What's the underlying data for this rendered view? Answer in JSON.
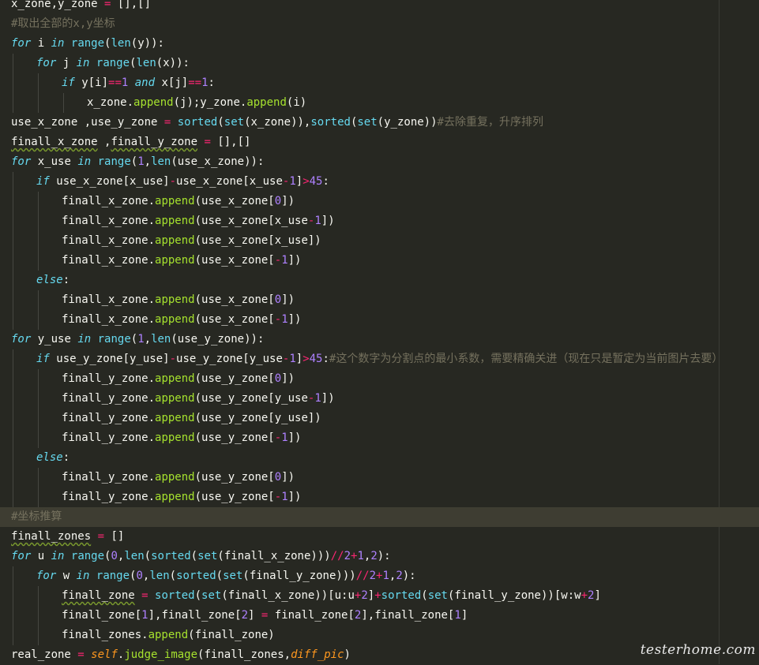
{
  "editor": {
    "colors": {
      "background": "#272822",
      "highlight": "#3e3d32",
      "text": "#f8f8f2",
      "keyword": "#66d9ef",
      "operator": "#f92672",
      "function": "#a6e22e",
      "number": "#ae81ff",
      "comment": "#75715e",
      "self": "#fd971f"
    },
    "lines": [
      {
        "indent": 0,
        "tokens": [
          [
            "x_zone,y_zone ",
            "t-default"
          ],
          [
            "=",
            "t-op"
          ],
          [
            " [],[]",
            "t-punc"
          ]
        ]
      },
      {
        "indent": 0,
        "tokens": [
          [
            "#取出全部的x,y坐标",
            "t-cm"
          ]
        ]
      },
      {
        "indent": 0,
        "tokens": [
          [
            "for",
            "t-kw"
          ],
          [
            " i ",
            "t-default"
          ],
          [
            "in",
            "t-kw"
          ],
          [
            " ",
            "t-default"
          ],
          [
            "range",
            "t-bi"
          ],
          [
            "(",
            "t-punc"
          ],
          [
            "len",
            "t-bi"
          ],
          [
            "(y)):",
            "t-punc"
          ]
        ]
      },
      {
        "indent": 1,
        "tokens": [
          [
            "for",
            "t-kw"
          ],
          [
            " j ",
            "t-default"
          ],
          [
            "in",
            "t-kw"
          ],
          [
            " ",
            "t-default"
          ],
          [
            "range",
            "t-bi"
          ],
          [
            "(",
            "t-punc"
          ],
          [
            "len",
            "t-bi"
          ],
          [
            "(x)):",
            "t-punc"
          ]
        ]
      },
      {
        "indent": 2,
        "tokens": [
          [
            "if",
            "t-kw"
          ],
          [
            " y[i]",
            "t-default"
          ],
          [
            "==",
            "t-op"
          ],
          [
            "1",
            "t-num"
          ],
          [
            " ",
            "t-default"
          ],
          [
            "and",
            "t-kw"
          ],
          [
            " x[j]",
            "t-default"
          ],
          [
            "==",
            "t-op"
          ],
          [
            "1",
            "t-num"
          ],
          [
            ":",
            "t-punc"
          ]
        ]
      },
      {
        "indent": 3,
        "tokens": [
          [
            "x_zone.",
            "t-default"
          ],
          [
            "append",
            "t-fn"
          ],
          [
            "(j);y_zone.",
            "t-default"
          ],
          [
            "append",
            "t-fn"
          ],
          [
            "(i)",
            "t-default"
          ]
        ]
      },
      {
        "indent": 0,
        "tokens": [
          [
            "use_x_zone ,use_y_zone ",
            "t-default"
          ],
          [
            "=",
            "t-op"
          ],
          [
            " ",
            "t-default"
          ],
          [
            "sorted",
            "t-bi"
          ],
          [
            "(",
            "t-punc"
          ],
          [
            "set",
            "t-bi"
          ],
          [
            "(x_zone)),",
            "t-default"
          ],
          [
            "sorted",
            "t-bi"
          ],
          [
            "(",
            "t-punc"
          ],
          [
            "set",
            "t-bi"
          ],
          [
            "(y_zone))",
            "t-default"
          ],
          [
            "#去除重复，升序排列",
            "t-cm"
          ]
        ]
      },
      {
        "indent": 0,
        "tokens": [
          [
            "finall_x_zone",
            "t-default u-wavy"
          ],
          [
            " ,",
            "t-default"
          ],
          [
            "finall_y_zone",
            "t-default u-wavy"
          ],
          [
            " ",
            "t-default"
          ],
          [
            "=",
            "t-op"
          ],
          [
            " [],[]",
            "t-punc"
          ]
        ]
      },
      {
        "indent": 0,
        "tokens": [
          [
            "for",
            "t-kw"
          ],
          [
            " x_use ",
            "t-default"
          ],
          [
            "in",
            "t-kw"
          ],
          [
            " ",
            "t-default"
          ],
          [
            "range",
            "t-bi"
          ],
          [
            "(",
            "t-punc"
          ],
          [
            "1",
            "t-num"
          ],
          [
            ",",
            "t-punc"
          ],
          [
            "len",
            "t-bi"
          ],
          [
            "(use_x_zone)):",
            "t-default"
          ]
        ]
      },
      {
        "indent": 1,
        "tokens": [
          [
            "if",
            "t-kw"
          ],
          [
            " use_x_zone[x_use]",
            "t-default"
          ],
          [
            "-",
            "t-op"
          ],
          [
            "use_x_zone[x_use",
            "t-default"
          ],
          [
            "-",
            "t-op"
          ],
          [
            "1",
            "t-num"
          ],
          [
            "]",
            "t-default"
          ],
          [
            ">",
            "t-op"
          ],
          [
            "45",
            "t-num"
          ],
          [
            ":",
            "t-punc"
          ]
        ]
      },
      {
        "indent": 2,
        "tokens": [
          [
            "finall_x_zone.",
            "t-default"
          ],
          [
            "append",
            "t-fn"
          ],
          [
            "(use_x_zone[",
            "t-default"
          ],
          [
            "0",
            "t-num"
          ],
          [
            "])",
            "t-default"
          ]
        ]
      },
      {
        "indent": 2,
        "tokens": [
          [
            "finall_x_zone.",
            "t-default"
          ],
          [
            "append",
            "t-fn"
          ],
          [
            "(use_x_zone[x_use",
            "t-default"
          ],
          [
            "-",
            "t-op"
          ],
          [
            "1",
            "t-num"
          ],
          [
            "])",
            "t-default"
          ]
        ]
      },
      {
        "indent": 2,
        "tokens": [
          [
            "finall_x_zone.",
            "t-default"
          ],
          [
            "append",
            "t-fn"
          ],
          [
            "(use_x_zone[x_use])",
            "t-default"
          ]
        ]
      },
      {
        "indent": 2,
        "tokens": [
          [
            "finall_x_zone.",
            "t-default"
          ],
          [
            "append",
            "t-fn"
          ],
          [
            "(use_x_zone[",
            "t-default"
          ],
          [
            "-",
            "t-op"
          ],
          [
            "1",
            "t-num"
          ],
          [
            "])",
            "t-default"
          ]
        ]
      },
      {
        "indent": 1,
        "tokens": [
          [
            "else",
            "t-kw"
          ],
          [
            ":",
            "t-punc"
          ]
        ]
      },
      {
        "indent": 2,
        "tokens": [
          [
            "finall_x_zone.",
            "t-default"
          ],
          [
            "append",
            "t-fn"
          ],
          [
            "(use_x_zone[",
            "t-default"
          ],
          [
            "0",
            "t-num"
          ],
          [
            "])",
            "t-default"
          ]
        ]
      },
      {
        "indent": 2,
        "tokens": [
          [
            "finall_x_zone.",
            "t-default"
          ],
          [
            "append",
            "t-fn"
          ],
          [
            "(use_x_zone[",
            "t-default"
          ],
          [
            "-",
            "t-op"
          ],
          [
            "1",
            "t-num"
          ],
          [
            "])",
            "t-default"
          ]
        ]
      },
      {
        "indent": 0,
        "tokens": [
          [
            "for",
            "t-kw"
          ],
          [
            " y_use ",
            "t-default"
          ],
          [
            "in",
            "t-kw"
          ],
          [
            " ",
            "t-default"
          ],
          [
            "range",
            "t-bi"
          ],
          [
            "(",
            "t-punc"
          ],
          [
            "1",
            "t-num"
          ],
          [
            ",",
            "t-punc"
          ],
          [
            "len",
            "t-bi"
          ],
          [
            "(use_y_zone)):",
            "t-default"
          ]
        ]
      },
      {
        "indent": 1,
        "tokens": [
          [
            "if",
            "t-kw"
          ],
          [
            " use_y_zone[y_use]",
            "t-default"
          ],
          [
            "-",
            "t-op"
          ],
          [
            "use_y_zone[y_use",
            "t-default"
          ],
          [
            "-",
            "t-op"
          ],
          [
            "1",
            "t-num"
          ],
          [
            "]",
            "t-default"
          ],
          [
            ">",
            "t-op"
          ],
          [
            "45",
            "t-num"
          ],
          [
            ":",
            "t-punc"
          ],
          [
            "#这个数字为分割点的最小系数，需要精确关进（现在只是暂定为当前图片去要）",
            "t-cm"
          ]
        ]
      },
      {
        "indent": 2,
        "tokens": [
          [
            "finall_y_zone.",
            "t-default"
          ],
          [
            "append",
            "t-fn"
          ],
          [
            "(use_y_zone[",
            "t-default"
          ],
          [
            "0",
            "t-num"
          ],
          [
            "])",
            "t-default"
          ]
        ]
      },
      {
        "indent": 2,
        "tokens": [
          [
            "finall_y_zone.",
            "t-default"
          ],
          [
            "append",
            "t-fn"
          ],
          [
            "(use_y_zone[y_use",
            "t-default"
          ],
          [
            "-",
            "t-op"
          ],
          [
            "1",
            "t-num"
          ],
          [
            "])",
            "t-default"
          ]
        ]
      },
      {
        "indent": 2,
        "tokens": [
          [
            "finall_y_zone.",
            "t-default"
          ],
          [
            "append",
            "t-fn"
          ],
          [
            "(use_y_zone[y_use])",
            "t-default"
          ]
        ]
      },
      {
        "indent": 2,
        "tokens": [
          [
            "finall_y_zone.",
            "t-default"
          ],
          [
            "append",
            "t-fn"
          ],
          [
            "(use_y_zone[",
            "t-default"
          ],
          [
            "-",
            "t-op"
          ],
          [
            "1",
            "t-num"
          ],
          [
            "])",
            "t-default"
          ]
        ]
      },
      {
        "indent": 1,
        "tokens": [
          [
            "else",
            "t-kw"
          ],
          [
            ":",
            "t-punc"
          ]
        ]
      },
      {
        "indent": 2,
        "tokens": [
          [
            "finall_y_zone.",
            "t-default"
          ],
          [
            "append",
            "t-fn"
          ],
          [
            "(use_y_zone[",
            "t-default"
          ],
          [
            "0",
            "t-num"
          ],
          [
            "])",
            "t-default"
          ]
        ]
      },
      {
        "indent": 2,
        "tokens": [
          [
            "finall_y_zone.",
            "t-default"
          ],
          [
            "append",
            "t-fn"
          ],
          [
            "(use_y_zone[",
            "t-default"
          ],
          [
            "-",
            "t-op"
          ],
          [
            "1",
            "t-num"
          ],
          [
            "])",
            "t-default"
          ]
        ]
      },
      {
        "indent": 0,
        "highlight": true,
        "tokens": [
          [
            "#坐标推算",
            "t-cm"
          ]
        ]
      },
      {
        "indent": 0,
        "tokens": [
          [
            "finall_zones",
            "t-default u-wavy"
          ],
          [
            " ",
            "t-default"
          ],
          [
            "=",
            "t-op"
          ],
          [
            " []",
            "t-punc"
          ]
        ]
      },
      {
        "indent": 0,
        "tokens": [
          [
            "for",
            "t-kw"
          ],
          [
            " u ",
            "t-default"
          ],
          [
            "in",
            "t-kw"
          ],
          [
            " ",
            "t-default"
          ],
          [
            "range",
            "t-bi"
          ],
          [
            "(",
            "t-punc"
          ],
          [
            "0",
            "t-num"
          ],
          [
            ",",
            "t-punc"
          ],
          [
            "len",
            "t-bi"
          ],
          [
            "(",
            "t-punc"
          ],
          [
            "sorted",
            "t-bi"
          ],
          [
            "(",
            "t-punc"
          ],
          [
            "set",
            "t-bi"
          ],
          [
            "(finall_x_zone)))",
            "t-default"
          ],
          [
            "//",
            "t-op"
          ],
          [
            "2",
            "t-num"
          ],
          [
            "+",
            "t-op"
          ],
          [
            "1",
            "t-num"
          ],
          [
            ",",
            "t-punc"
          ],
          [
            "2",
            "t-num"
          ],
          [
            "):",
            "t-punc"
          ]
        ]
      },
      {
        "indent": 1,
        "tokens": [
          [
            "for",
            "t-kw"
          ],
          [
            " w ",
            "t-default"
          ],
          [
            "in",
            "t-kw"
          ],
          [
            " ",
            "t-default"
          ],
          [
            "range",
            "t-bi"
          ],
          [
            "(",
            "t-punc"
          ],
          [
            "0",
            "t-num"
          ],
          [
            ",",
            "t-punc"
          ],
          [
            "len",
            "t-bi"
          ],
          [
            "(",
            "t-punc"
          ],
          [
            "sorted",
            "t-bi"
          ],
          [
            "(",
            "t-punc"
          ],
          [
            "set",
            "t-bi"
          ],
          [
            "(finall_y_zone)))",
            "t-default"
          ],
          [
            "//",
            "t-op"
          ],
          [
            "2",
            "t-num"
          ],
          [
            "+",
            "t-op"
          ],
          [
            "1",
            "t-num"
          ],
          [
            ",",
            "t-punc"
          ],
          [
            "2",
            "t-num"
          ],
          [
            "):",
            "t-punc"
          ]
        ]
      },
      {
        "indent": 2,
        "tokens": [
          [
            "finall_zone",
            "t-default u-wavy"
          ],
          [
            " ",
            "t-default"
          ],
          [
            "=",
            "t-op"
          ],
          [
            " ",
            "t-default"
          ],
          [
            "sorted",
            "t-bi"
          ],
          [
            "(",
            "t-punc"
          ],
          [
            "set",
            "t-bi"
          ],
          [
            "(finall_x_zone))[u:u",
            "t-default"
          ],
          [
            "+",
            "t-op"
          ],
          [
            "2",
            "t-num"
          ],
          [
            "]",
            "t-default"
          ],
          [
            "+",
            "t-op"
          ],
          [
            "sorted",
            "t-bi"
          ],
          [
            "(",
            "t-punc"
          ],
          [
            "set",
            "t-bi"
          ],
          [
            "(finall_y_zone))[w:w",
            "t-default"
          ],
          [
            "+",
            "t-op"
          ],
          [
            "2",
            "t-num"
          ],
          [
            "]",
            "t-default"
          ]
        ]
      },
      {
        "indent": 2,
        "tokens": [
          [
            "finall_zone[",
            "t-default"
          ],
          [
            "1",
            "t-num"
          ],
          [
            "],finall_zone[",
            "t-default"
          ],
          [
            "2",
            "t-num"
          ],
          [
            "] ",
            "t-default"
          ],
          [
            "=",
            "t-op"
          ],
          [
            " finall_zone[",
            "t-default"
          ],
          [
            "2",
            "t-num"
          ],
          [
            "],finall_zone[",
            "t-default"
          ],
          [
            "1",
            "t-num"
          ],
          [
            "]",
            "t-default"
          ]
        ]
      },
      {
        "indent": 2,
        "tokens": [
          [
            "finall_zones.",
            "t-default"
          ],
          [
            "append",
            "t-fn"
          ],
          [
            "(finall_zone)",
            "t-default"
          ]
        ]
      },
      {
        "indent": 0,
        "tokens": [
          [
            "real_zone ",
            "t-default"
          ],
          [
            "=",
            "t-op"
          ],
          [
            " ",
            "t-default"
          ],
          [
            "self",
            "t-self"
          ],
          [
            ".",
            "t-punc"
          ],
          [
            "judge_image",
            "t-fn"
          ],
          [
            "(finall_zones,",
            "t-default"
          ],
          [
            "diff_pic",
            "t-arg"
          ],
          [
            ")",
            "t-default"
          ]
        ]
      }
    ]
  },
  "watermark": {
    "text": "testerhome.com"
  }
}
